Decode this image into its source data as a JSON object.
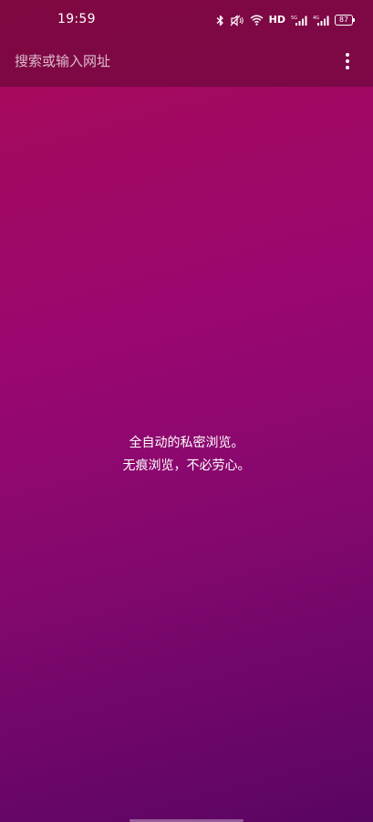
{
  "status_bar": {
    "time": "19:59",
    "network_label": "HD",
    "signal_1_label": "5G",
    "signal_2_label": "4G",
    "battery_level": "87",
    "icons": [
      "bluetooth-icon",
      "mute-vibrate-icon",
      "wifi-icon",
      "signal-icon",
      "signal-icon",
      "battery-icon"
    ]
  },
  "toolbar": {
    "search_placeholder": "搜索或输入网址",
    "menu_icon": "more-vertical-icon"
  },
  "incognito": {
    "line1": "全自动的私密浏览。",
    "line2": "无痕浏览，不必劳心。"
  },
  "colors": {
    "gradient_top": "#a80a55",
    "gradient_mid": "#9a0770",
    "gradient_bottom": "#5a0562",
    "text": "#ffffff"
  }
}
